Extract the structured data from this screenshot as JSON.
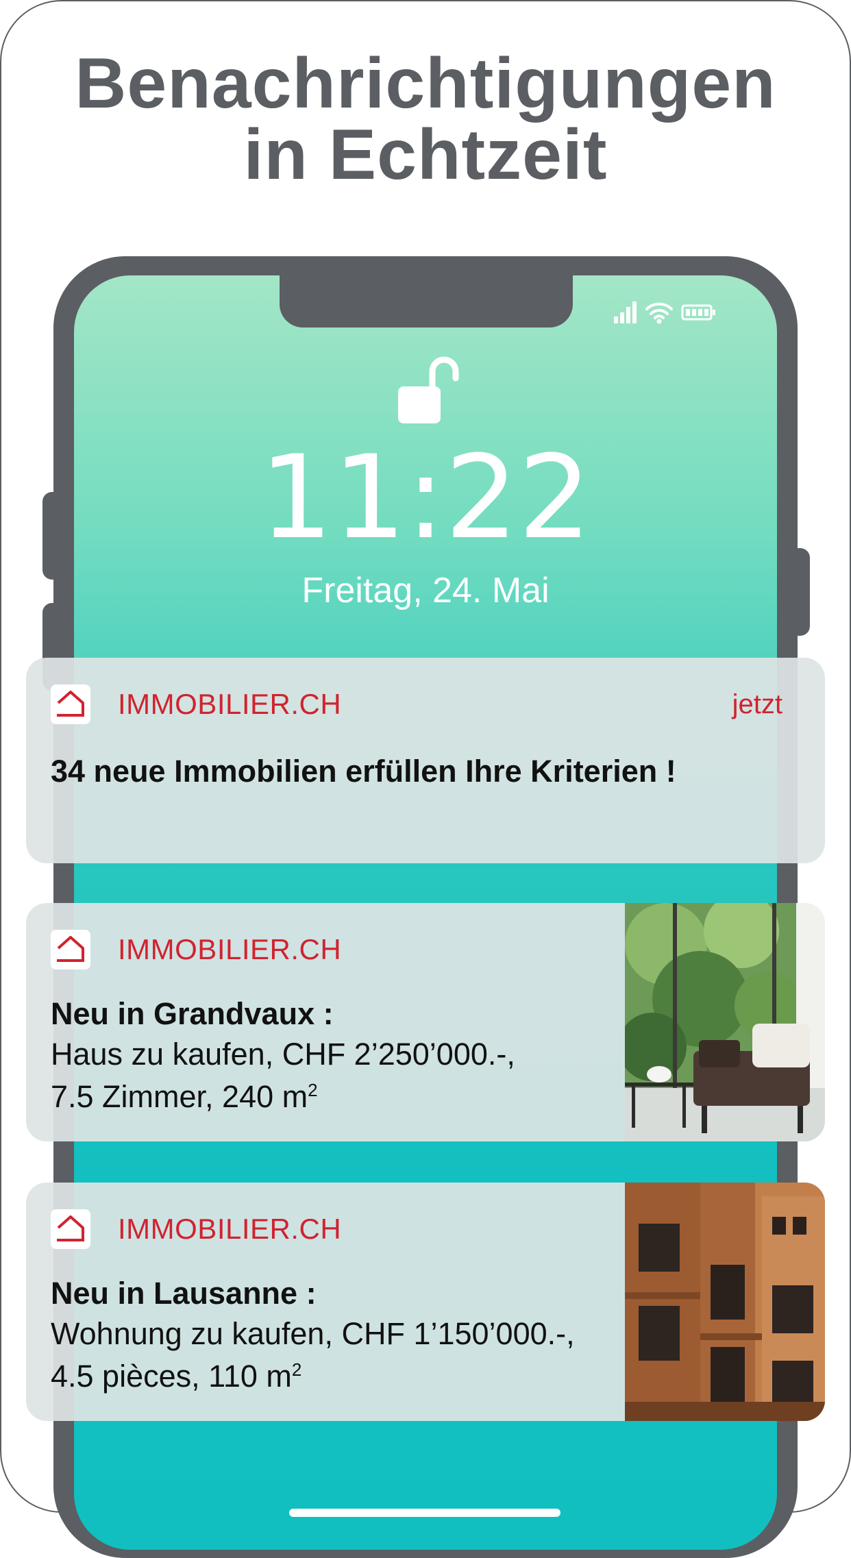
{
  "headline": {
    "line1": "Benachrichtigungen",
    "line2": "in Echtzeit"
  },
  "lockscreen": {
    "time": "11:22",
    "date": "Freitag, 24. Mai"
  },
  "notifications": [
    {
      "app": "IMMOBILIER.CH",
      "time": "jetzt",
      "title": "34 neue Immobilien erfüllen Ihre Kriterien !"
    },
    {
      "app": "IMMOBILIER.CH",
      "title": "Neu in Grandvaux :",
      "line1": "Haus zu kaufen, CHF 2’250’000.-,",
      "line2": "7.5 Zimmer, 240 m",
      "unit_sup": "2",
      "photo": "patio-armchair-garden"
    },
    {
      "app": "IMMOBILIER.CH",
      "title": "Neu in Lausanne :",
      "line1": "Wohnung zu kaufen, CHF 1’150’000.-,",
      "line2": "4.5 pièces, 110 m",
      "unit_sup": "2",
      "photo": "wooden-apartment-building"
    }
  ],
  "colors": {
    "brand_red": "#d0232f",
    "frame_gray": "#5b5e62",
    "screen_top": "#a3e6c6",
    "screen_bottom": "#11bfc1"
  }
}
